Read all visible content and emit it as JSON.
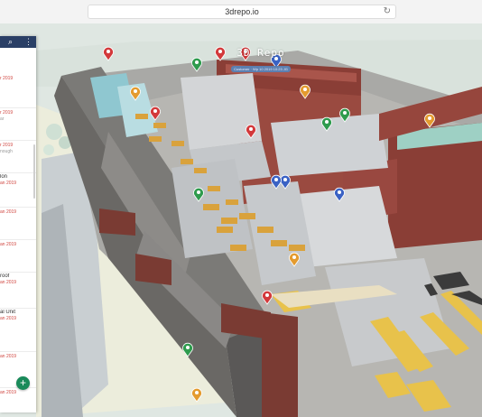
{
  "browser": {
    "url": "3drepo.io",
    "reload_icon": "reload-icon"
  },
  "brand": {
    "name": "3D Repo",
    "subtitle": "Customer · Wp 10 2019 10:23 JG"
  },
  "panel": {
    "header_icons": [
      "search-icon",
      "more-icon"
    ],
    "add_button_label": "+",
    "issues": [
      {
        "title": "",
        "date": "r 2019",
        "extra": ""
      },
      {
        "title": "",
        "date": "r 2019",
        "extra": "ar"
      },
      {
        "title": "",
        "date": "r 2019",
        "extra": "nough"
      },
      {
        "title": "lon",
        "date": "an 2019",
        "extra": ""
      },
      {
        "title": "",
        "date": "an 2019",
        "extra": ""
      },
      {
        "title": "",
        "date": "an 2019",
        "extra": ""
      },
      {
        "title": "roof",
        "date": "an 2019",
        "extra": ""
      },
      {
        "title": "al Unit",
        "date": "an 2019",
        "extra": ""
      },
      {
        "title": "",
        "date": "an 2019",
        "extra": ""
      },
      {
        "title": "",
        "date": "an 2019",
        "extra": ""
      }
    ]
  },
  "pins": [
    {
      "color": "#d3393b"
    },
    {
      "color": "#d3393b"
    },
    {
      "color": "#d3393b"
    },
    {
      "color": "#d3393b"
    },
    {
      "color": "#2e9b4d"
    },
    {
      "color": "#2e9b4d"
    },
    {
      "color": "#2e9b4d"
    },
    {
      "color": "#2e9b4d"
    },
    {
      "color": "#2e9b4d"
    },
    {
      "color": "#e49b2f"
    },
    {
      "color": "#e49b2f"
    },
    {
      "color": "#e49b2f"
    },
    {
      "color": "#e49b2f"
    },
    {
      "color": "#e49b2f"
    },
    {
      "color": "#3a62c4"
    },
    {
      "color": "#3a62c4"
    },
    {
      "color": "#3a62c4"
    },
    {
      "color": "#3a62c4"
    },
    {
      "color": "#d3393b"
    },
    {
      "color": "#d3393b"
    }
  ]
}
